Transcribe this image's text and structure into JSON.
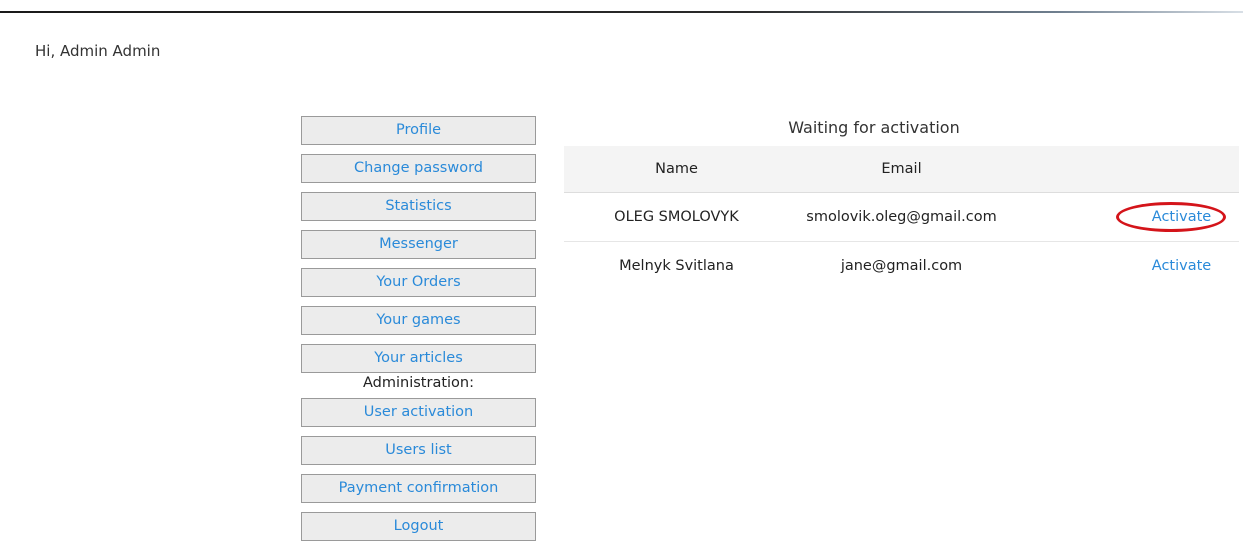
{
  "greeting": "Hi, Admin Admin",
  "menu": {
    "items": [
      {
        "label": "Profile",
        "name": "menu-profile"
      },
      {
        "label": "Change password",
        "name": "menu-change-password"
      },
      {
        "label": "Statistics",
        "name": "menu-statistics"
      },
      {
        "label": "Messenger",
        "name": "menu-messenger"
      },
      {
        "label": "Your Orders",
        "name": "menu-your-orders"
      },
      {
        "label": "Your games",
        "name": "menu-your-games"
      },
      {
        "label": "Your articles",
        "name": "menu-your-articles"
      }
    ],
    "admin_heading": "Administration:",
    "admin_items": [
      {
        "label": "User activation",
        "name": "menu-user-activation"
      },
      {
        "label": "Users list",
        "name": "menu-users-list"
      },
      {
        "label": "Payment confirmation",
        "name": "menu-payment-confirmation"
      },
      {
        "label": "Logout",
        "name": "menu-logout"
      }
    ]
  },
  "panel": {
    "title": "Waiting for activation",
    "columns": {
      "name": "Name",
      "email": "Email"
    },
    "rows": [
      {
        "name": "OLEG SMOLOVYK",
        "email": "smolovik.oleg@gmail.com",
        "action": "Activate"
      },
      {
        "name": "Melnyk Svitlana",
        "email": "jane@gmail.com",
        "action": "Activate"
      }
    ]
  },
  "colors": {
    "link": "#2a8ad9",
    "annotation": "#d4141a",
    "button_bg": "#ececec",
    "header_bg": "#f4f4f4"
  }
}
